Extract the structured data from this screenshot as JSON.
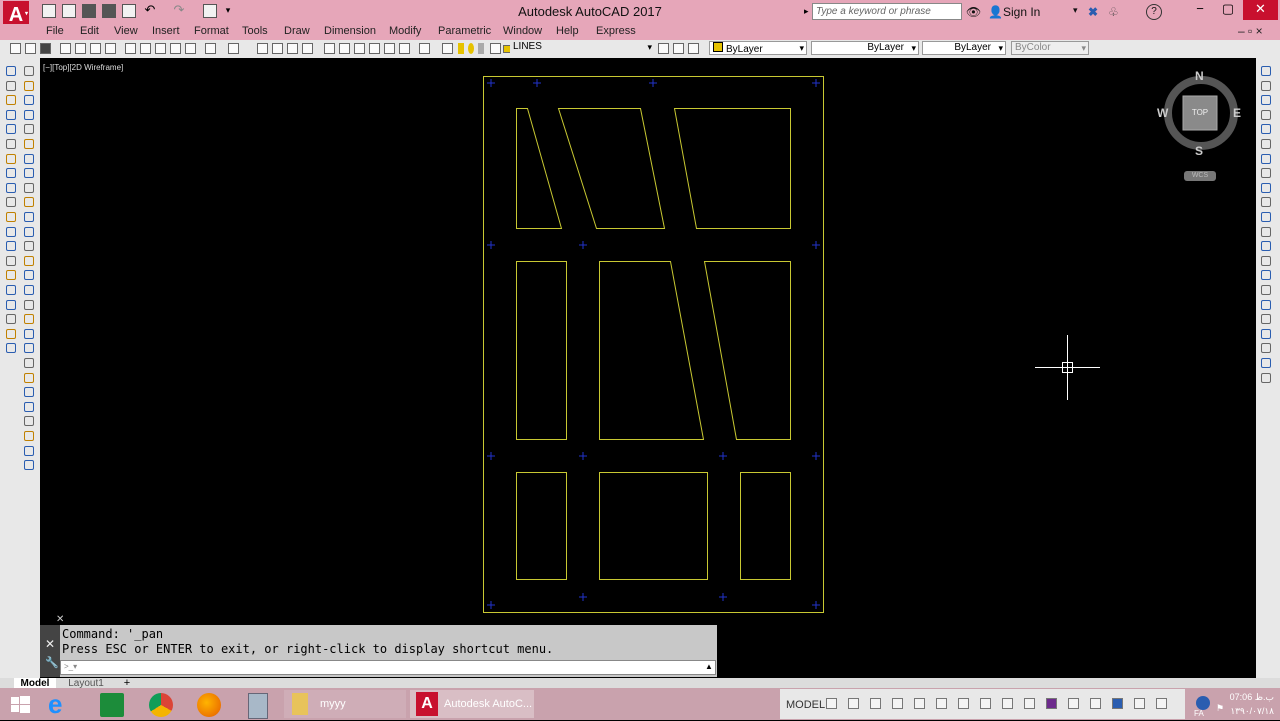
{
  "window": {
    "title": "Autodesk AutoCAD 2017",
    "logo_letter": "A",
    "search_placeholder": "Type a keyword or phrase",
    "sign_in": "Sign In",
    "help": "?",
    "minimize": "−",
    "maximize": "▢",
    "close": "✕"
  },
  "menu": [
    "File",
    "Edit",
    "View",
    "Insert",
    "Format",
    "Tools",
    "Draw",
    "Dimension",
    "Modify",
    "Parametric",
    "Window",
    "Help",
    "Express"
  ],
  "toolbar": {
    "layer": "LINES",
    "color": "ByLayer",
    "linetype": "ByLayer",
    "lineweight": "ByLayer",
    "plotstyle": "ByColor"
  },
  "viewport": {
    "label": "[−][Top][2D Wireframe]",
    "drawing_color": "#c8c832",
    "grip_color": "#2233cc"
  },
  "viewcube": {
    "north": "N",
    "south": "S",
    "east": "E",
    "west": "W",
    "top": "TOP",
    "wcs": "WCS"
  },
  "command": {
    "line1": "Command: '_pan",
    "line2": "Press ESC or ENTER to exit, or right-click to display shortcut menu.",
    "input": ""
  },
  "tabs": {
    "model": "Model",
    "layout1": "Layout1",
    "add": "+"
  },
  "taskbar": {
    "folder_label": "myyy",
    "autocad_label": "Autodesk AutoC...",
    "status_model": "MODEL",
    "clock_time": "07:06 ب.ظ",
    "clock_date": "۱۳۹۰/۰۷/۱۸",
    "lang": "FA"
  }
}
